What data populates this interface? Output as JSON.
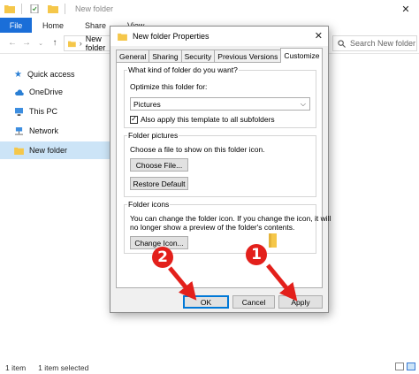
{
  "explorer": {
    "title": "New folder",
    "ribbon_tabs": [
      "File",
      "Home",
      "Share",
      "View"
    ],
    "address_folder": "New folder",
    "search_placeholder": "Search New folder",
    "nav_items": [
      "Quick access",
      "OneDrive",
      "This PC",
      "Network",
      "New folder"
    ],
    "status_items": "1 item",
    "status_selected": "1 item selected"
  },
  "dialog": {
    "title": "New folder Properties",
    "tabs": [
      "General",
      "Sharing",
      "Security",
      "Previous Versions",
      "Customize"
    ],
    "active_tab": "Customize",
    "group1_label": "What kind of folder do you want?",
    "optimize_label": "Optimize this folder for:",
    "optimize_value": "Pictures",
    "apply_subfolders_label": "Also apply this template to all subfolders",
    "apply_subfolders_checked": true,
    "group2_label": "Folder pictures",
    "choose_file_text": "Choose a file to show on this folder icon.",
    "choose_file_button": "Choose File...",
    "restore_default_button": "Restore Default",
    "group3_label": "Folder icons",
    "folder_icons_text_1": "You can change the folder icon. If you change the icon, it will",
    "folder_icons_text_2": "no longer show a preview of the folder's contents.",
    "change_icon_button": "Change Icon...",
    "ok_button": "OK",
    "cancel_button": "Cancel",
    "apply_button": "Apply"
  },
  "annotations": {
    "step1": "1",
    "step2": "2",
    "color": "#e3201b"
  },
  "colors": {
    "accent": "#1a6ed8",
    "selection": "#cce4f7",
    "folder": "#f5c74a"
  }
}
